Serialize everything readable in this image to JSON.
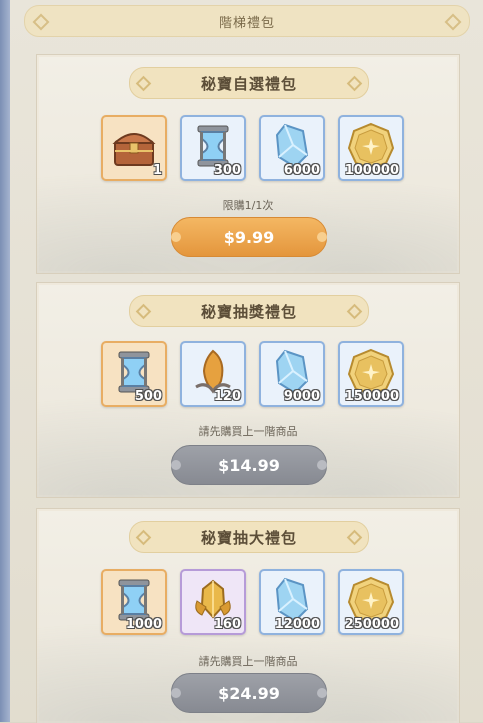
{
  "header": {
    "title": "階梯禮包"
  },
  "packs": [
    {
      "title": "秘寶自選禮包",
      "items": [
        {
          "icon": "treasure-chest-icon",
          "qty": "1",
          "rarity": "orange"
        },
        {
          "icon": "hourglass-icon",
          "qty": "300",
          "rarity": "blue"
        },
        {
          "icon": "blue-crystal-icon",
          "qty": "6000",
          "rarity": "blue"
        },
        {
          "icon": "gold-coin-icon",
          "qty": "100000",
          "rarity": "blue"
        }
      ],
      "note": "限購1/1次",
      "price": "$9.99",
      "state": "active"
    },
    {
      "title": "秘寶抽獎禮包",
      "items": [
        {
          "icon": "hourglass-icon",
          "qty": "500",
          "rarity": "orange"
        },
        {
          "icon": "amber-crystal-icon",
          "qty": "120",
          "rarity": "blue"
        },
        {
          "icon": "blue-crystal-icon",
          "qty": "9000",
          "rarity": "blue"
        },
        {
          "icon": "gold-coin-icon",
          "qty": "150000",
          "rarity": "blue"
        }
      ],
      "note": "請先購買上一階商品",
      "price": "$14.99",
      "state": "locked"
    },
    {
      "title": "秘寶抽大禮包",
      "items": [
        {
          "icon": "hourglass-icon",
          "qty": "1000",
          "rarity": "orange"
        },
        {
          "icon": "golden-crystal-icon",
          "qty": "160",
          "rarity": "purple"
        },
        {
          "icon": "blue-crystal-icon",
          "qty": "12000",
          "rarity": "blue"
        },
        {
          "icon": "gold-coin-icon",
          "qty": "250000",
          "rarity": "blue"
        }
      ],
      "note": "請先購買上一階商品",
      "price": "$24.99",
      "state": "locked"
    }
  ]
}
